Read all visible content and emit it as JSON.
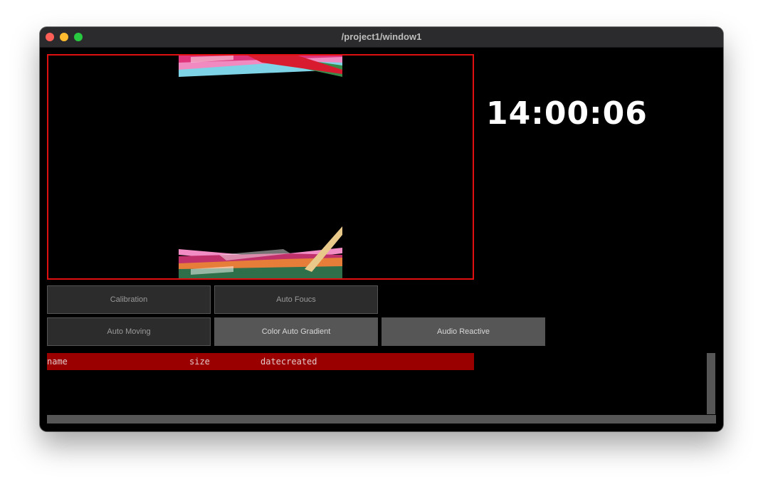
{
  "window": {
    "title": "/project1/window1"
  },
  "clock": {
    "time": "14:00:06"
  },
  "buttons": {
    "row1": [
      {
        "label": "Calibration",
        "active": false
      },
      {
        "label": "Auto Foucs",
        "active": false
      }
    ],
    "row2": [
      {
        "label": "Auto Moving",
        "active": false
      },
      {
        "label": "Color Auto Gradient",
        "active": true
      },
      {
        "label": "Audio Reactive",
        "active": true
      }
    ]
  },
  "table": {
    "columns": [
      "name",
      "size",
      "datecreated"
    ]
  },
  "colors": {
    "preview_border": "#e01010",
    "table_header": "#9b0000",
    "button_dark": "#2c2c2c",
    "button_light": "#565656"
  }
}
